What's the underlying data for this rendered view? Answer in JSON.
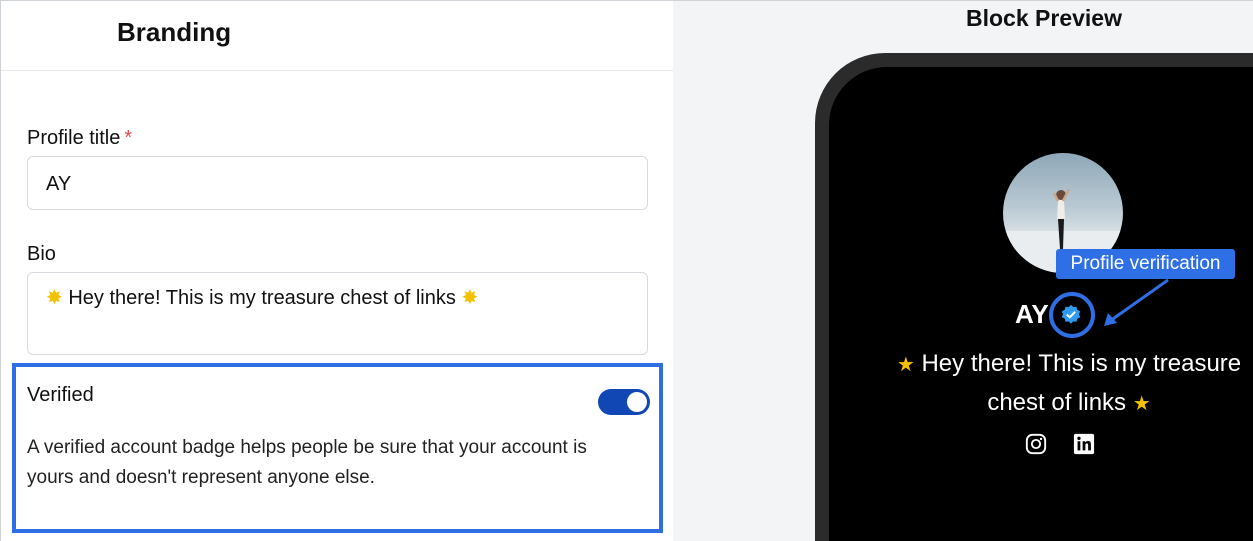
{
  "left_panel": {
    "title": "Branding",
    "profile_title": {
      "label": "Profile title",
      "required_mark": "*",
      "value": "AY"
    },
    "bio": {
      "label": "Bio",
      "value": "Hey there! This is my treasure chest of links"
    },
    "verified": {
      "title": "Verified",
      "toggle_on": true,
      "description": "A verified account badge helps people be sure that your account is yours and doesn't represent anyone else."
    }
  },
  "preview": {
    "title": "Block Preview",
    "profile_name": "AY",
    "bio_line1": "Hey there! This is my treasure",
    "bio_line2": "chest of links",
    "social_icons": [
      "instagram-icon",
      "linkedin-icon"
    ],
    "annotation": "Profile verification"
  },
  "colors": {
    "accent_blue": "#2e6fe6",
    "toggle_blue": "#1147b5",
    "required_red": "#e5484d",
    "sparkle_yellow": "#f2c200",
    "preview_bg": "#f2f4f6"
  }
}
